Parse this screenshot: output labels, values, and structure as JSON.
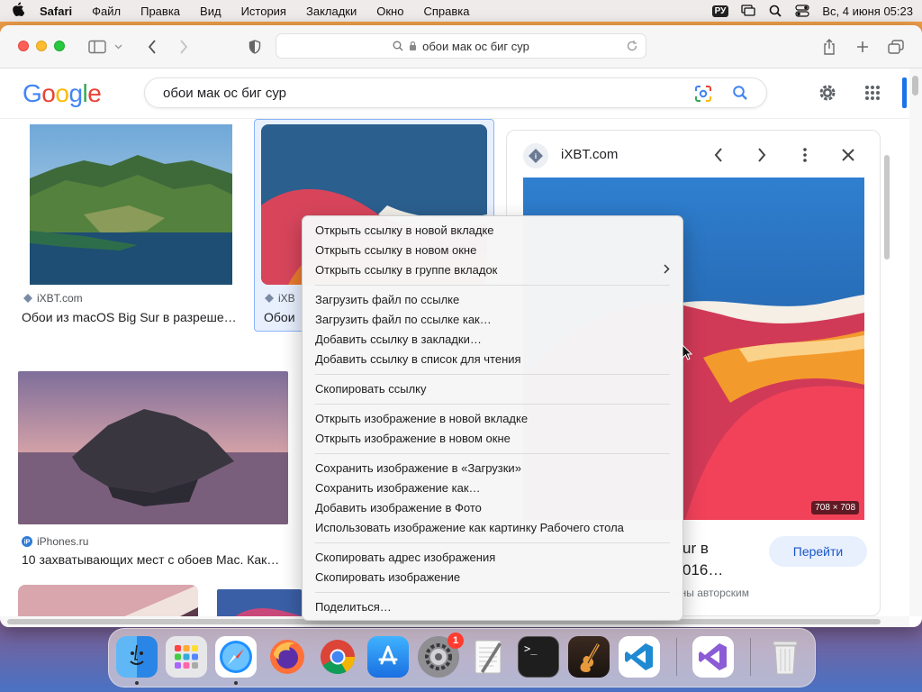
{
  "menubar": {
    "app": "Safari",
    "items": [
      "Файл",
      "Правка",
      "Вид",
      "История",
      "Закладки",
      "Окно",
      "Справка"
    ],
    "input_lang": "РУ",
    "datetime": "Вс, 4 июня  05:23"
  },
  "toolbar": {
    "address": "обои мак ос биг сур"
  },
  "google": {
    "logo": [
      "G",
      "o",
      "o",
      "g",
      "l",
      "e"
    ],
    "logo_colors": [
      "#4285F4",
      "#EA4335",
      "#FBBC05",
      "#4285F4",
      "#34A853",
      "#EA4335"
    ],
    "query": "обои мак ос биг сур"
  },
  "results": [
    {
      "source": "iXBT.com",
      "title": "Обои из macOS Big Sur в разреше…"
    },
    {
      "source": "iXB",
      "title": "Обои"
    },
    {
      "source": "iPhones.ru",
      "title": "10 захватывающих мест с обоев Mac. Как…"
    }
  ],
  "panel": {
    "source": "iXBT.com",
    "dimensions": "708 × 708",
    "title_line1": "ur в",
    "title_line2": "016…",
    "note": "ены авторским",
    "go_button": "Перейти"
  },
  "context_menu": {
    "groups": [
      [
        "Открыть ссылку в новой вкладке",
        "Открыть ссылку в новом окне",
        "Открыть ссылку в группе вкладок"
      ],
      [
        "Загрузить файл по ссылке",
        "Загрузить файл по ссылке как…",
        "Добавить ссылку в закладки…",
        "Добавить ссылку в список для чтения"
      ],
      [
        "Скопировать ссылку"
      ],
      [
        "Открыть изображение в новой вкладке",
        "Открыть изображение в новом окне"
      ],
      [
        "Сохранить изображение в «Загрузки»",
        "Сохранить изображение как…",
        "Добавить изображение в Фото",
        "Использовать изображение как картинку Рабочего стола"
      ],
      [
        "Скопировать адрес изображения",
        "Скопировать изображение"
      ],
      [
        "Поделиться…"
      ]
    ]
  },
  "dock": {
    "apps": [
      "Finder",
      "Launchpad",
      "Safari",
      "Firefox",
      "Chrome",
      "App Store",
      "System Settings",
      "TextEdit",
      "Terminal",
      "GarageBand",
      "Visual Studio Code",
      "Visual Studio",
      "Trash"
    ],
    "settings_badge": "1",
    "terminal_prompt": ">_"
  }
}
